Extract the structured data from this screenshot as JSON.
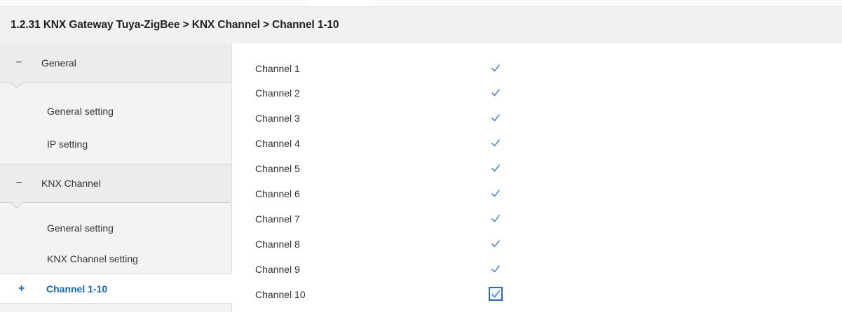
{
  "breadcrumb": "1.2.31 KNX Gateway Tuya-ZigBee > KNX Channel > Channel 1-10",
  "sidebar": {
    "groups": [
      {
        "toggle": "−",
        "label": "General",
        "items": [
          "General setting",
          "IP setting"
        ]
      },
      {
        "toggle": "−",
        "label": "KNX Channel",
        "items": [
          "General setting",
          "KNX Channel setting"
        ]
      }
    ],
    "selected": {
      "toggle": "+",
      "label": "Channel 1-10"
    }
  },
  "channels": [
    {
      "label": "Channel 1",
      "checked": true
    },
    {
      "label": "Channel 2",
      "checked": true
    },
    {
      "label": "Channel 3",
      "checked": true
    },
    {
      "label": "Channel 4",
      "checked": true
    },
    {
      "label": "Channel 5",
      "checked": true
    },
    {
      "label": "Channel 6",
      "checked": true
    },
    {
      "label": "Channel 7",
      "checked": true
    },
    {
      "label": "Channel 8",
      "checked": true
    },
    {
      "label": "Channel 9",
      "checked": true
    },
    {
      "label": "Channel 10",
      "checked": true,
      "focused": true
    }
  ],
  "colors": {
    "accent": "#1565b8",
    "check": "#2f74c4"
  },
  "icons": {
    "check": "checkmark-icon",
    "collapse": "minus-icon",
    "expand": "plus-icon"
  }
}
